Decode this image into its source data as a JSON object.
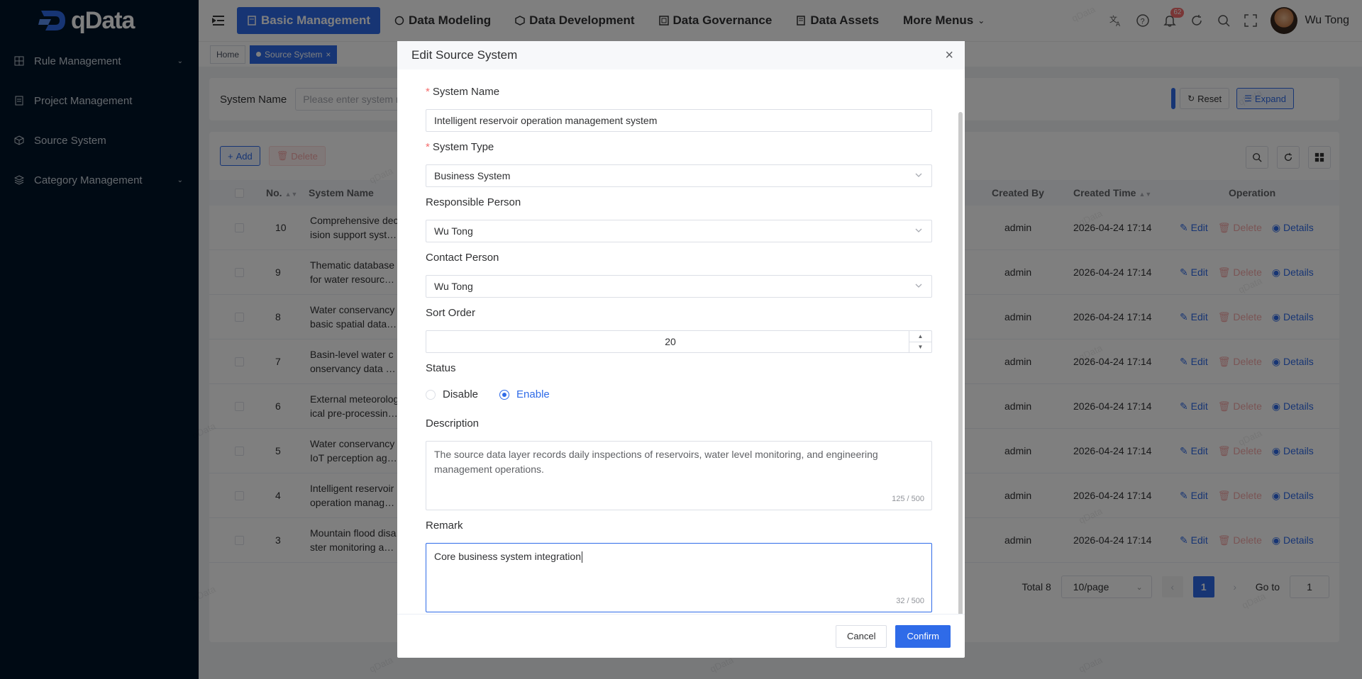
{
  "app": {
    "logo_text": "qData"
  },
  "sidebar": {
    "items": [
      {
        "label": "Rule Management",
        "icon": "grid-icon",
        "has_children": true
      },
      {
        "label": "Project Management",
        "icon": "document-icon",
        "has_children": false
      },
      {
        "label": "Source System",
        "icon": "cube-icon",
        "has_children": false
      },
      {
        "label": "Category Management",
        "icon": "layers-icon",
        "has_children": true
      }
    ]
  },
  "topnav": {
    "items": [
      {
        "label": "Basic Management",
        "active": true
      },
      {
        "label": "Data Modeling",
        "active": false
      },
      {
        "label": "Data Development",
        "active": false
      },
      {
        "label": "Data Governance",
        "active": false
      },
      {
        "label": "Data Assets",
        "active": false
      },
      {
        "label": "More Menus",
        "active": false
      }
    ],
    "notification_count": "62",
    "user_name": "Wu Tong"
  },
  "tags": {
    "home": "Home",
    "current": "Source System"
  },
  "search": {
    "label": "System Name",
    "placeholder": "Please enter system n",
    "reset": "Reset",
    "expand": "Expand"
  },
  "toolbar": {
    "add": "Add",
    "delete": "Delete"
  },
  "table": {
    "headers": {
      "no": "No.",
      "system_name": "System Name",
      "created_by": "Created By",
      "created_time": "Created Time",
      "operation": "Operation"
    },
    "ops": {
      "edit": "Edit",
      "delete": "Delete",
      "details": "Details"
    },
    "rows": [
      {
        "no": "10",
        "name1": "Comprehensive dec",
        "name2": "ision support syst…",
        "created_by": "admin",
        "created_time": "2026-04-24 17:14"
      },
      {
        "no": "9",
        "name1": "Thematic database",
        "name2": "for water resourc…",
        "created_by": "admin",
        "created_time": "2026-04-24 17:14"
      },
      {
        "no": "8",
        "name1": "Water conservancy",
        "name2": "basic spatial data…",
        "created_by": "admin",
        "created_time": "2026-04-24 17:14"
      },
      {
        "no": "7",
        "name1": "Basin-level water c",
        "name2": "onservancy data …",
        "created_by": "admin",
        "created_time": "2026-04-24 17:14"
      },
      {
        "no": "6",
        "name1": "External meteorolog",
        "name2": "ical pre-processin…",
        "created_by": "admin",
        "created_time": "2026-04-24 17:14"
      },
      {
        "no": "5",
        "name1": "Water conservancy",
        "name2": "IoT perception ag…",
        "created_by": "admin",
        "created_time": "2026-04-24 17:14"
      },
      {
        "no": "4",
        "name1": "Intelligent reservoir",
        "name2": "operation manag…",
        "created_by": "admin",
        "created_time": "2026-04-24 17:14"
      },
      {
        "no": "3",
        "name1": "Mountain flood disa",
        "name2": "ster monitoring a…",
        "created_by": "admin",
        "created_time": "2026-04-24 17:14"
      }
    ]
  },
  "pagination": {
    "total": "Total 8",
    "page_size": "10/page",
    "current": "1",
    "goto_label": "Go to",
    "goto_value": "1"
  },
  "watermark": "qData",
  "modal": {
    "title": "Edit Source System",
    "system_name": {
      "label": "System Name",
      "value": "Intelligent reservoir operation management system"
    },
    "system_type": {
      "label": "System Type",
      "value": "Business System"
    },
    "responsible_person": {
      "label": "Responsible Person",
      "value": "Wu Tong"
    },
    "contact_person": {
      "label": "Contact Person",
      "value": "Wu Tong"
    },
    "sort_order": {
      "label": "Sort Order",
      "value": "20"
    },
    "status": {
      "label": "Status",
      "options": [
        "Disable",
        "Enable"
      ],
      "selected": "Enable"
    },
    "description": {
      "label": "Description",
      "value": "The source data layer records daily inspections of reservoirs, water level monitoring, and engineering management operations.",
      "count": "125 / 500"
    },
    "remark": {
      "label": "Remark",
      "value": "Core business system integration",
      "count": "32 / 500"
    },
    "cancel": "Cancel",
    "confirm": "Confirm"
  }
}
